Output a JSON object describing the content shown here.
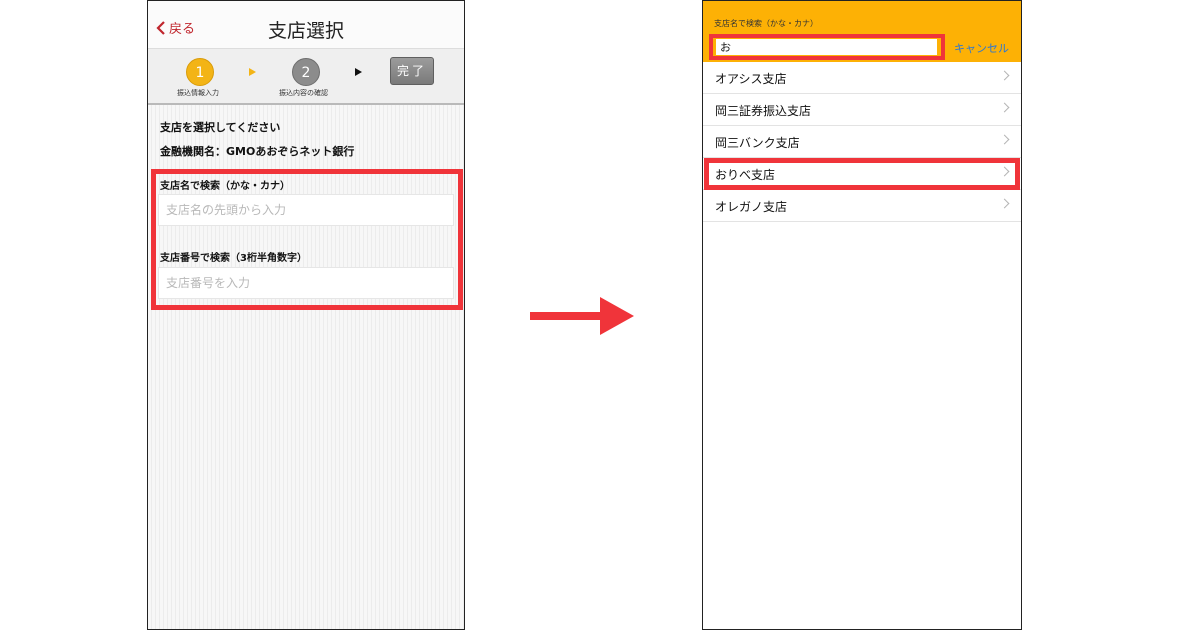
{
  "left_screen": {
    "nav": {
      "back_label": "戻る",
      "title": "支店選択"
    },
    "steps": [
      {
        "number": "1",
        "label": "振込情報入力",
        "state": "active",
        "color": "#f3b416"
      },
      {
        "number": "2",
        "label": "振込内容の確認",
        "state": "inactive",
        "color": "#8c8c8c"
      }
    ],
    "done_label": "完了",
    "instruction": "支店を選択してください",
    "bank_name": "金融機関名：GMOあおぞらネット銀行",
    "name_search": {
      "label": "支店名で検索（かな・カナ）",
      "placeholder": "支店名の先頭から入力"
    },
    "number_search": {
      "label": "支店番号で検索（3桁半角数字）",
      "placeholder": "支店番号を入力"
    }
  },
  "right_screen": {
    "search": {
      "caption": "支店名で検索（かな・カナ）",
      "value": "お",
      "cancel_label": "キャンセル"
    },
    "results": [
      {
        "label": "オアシス支店"
      },
      {
        "label": "岡三証券振込支店"
      },
      {
        "label": "岡三バンク支店"
      },
      {
        "label": "おりべ支店",
        "highlighted": true
      },
      {
        "label": "オレガノ支店"
      }
    ]
  },
  "colors": {
    "highlight_frame": "#f0343a",
    "header_yellow": "#fdb105",
    "accent_red": "#c0262d",
    "link_blue": "#2a77d4"
  },
  "icons": {
    "back": "chevron-left-icon",
    "row": "chevron-right-icon",
    "flow": "arrow-right-icon"
  }
}
